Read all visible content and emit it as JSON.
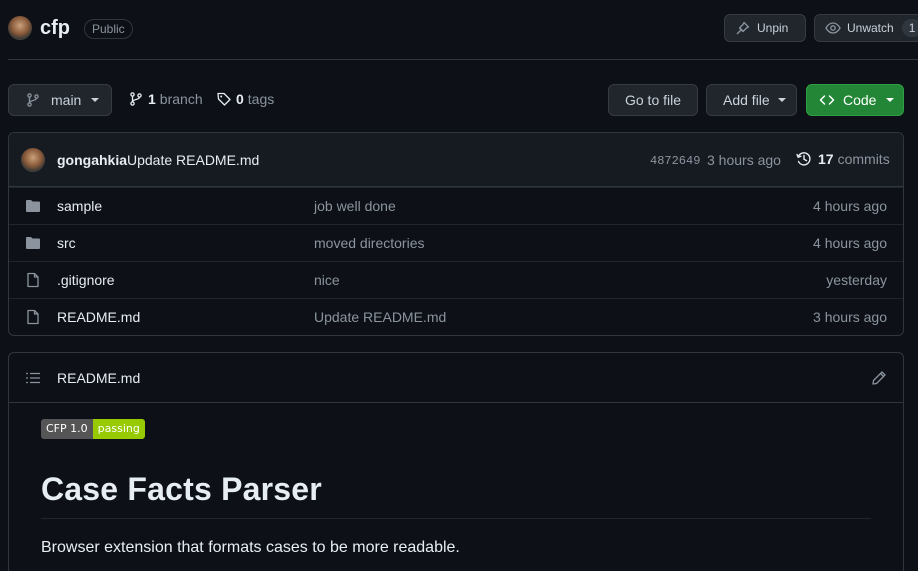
{
  "repo": {
    "name": "cfp",
    "visibility": "Public",
    "unpin_label": "Unpin",
    "unwatch_label": "Unwatch",
    "watch_count": "1"
  },
  "toolbar": {
    "branch": "main",
    "branch_count": "1",
    "branch_word": "branch",
    "tag_count": "0",
    "tag_word": "tags",
    "goto_label": "Go to file",
    "addfile_label": "Add file",
    "code_label": "Code"
  },
  "commit": {
    "author": "gongahkia",
    "message": "Update README.md",
    "sha": "4872649",
    "time": "3 hours ago",
    "count": "17",
    "count_word": "commits"
  },
  "files": [
    {
      "name": "sample",
      "type": "folder",
      "message": "job well done",
      "age": "4 hours ago"
    },
    {
      "name": "src",
      "type": "folder",
      "message": "moved directories",
      "age": "4 hours ago"
    },
    {
      "name": ".gitignore",
      "type": "file",
      "message": "nice",
      "age": "yesterday"
    },
    {
      "name": "README.md",
      "type": "file",
      "message": "Update README.md",
      "age": "3 hours ago"
    }
  ],
  "readme": {
    "filename": "README.md",
    "badge_left": "CFP 1.0",
    "badge_right": "passing",
    "heading": "Case Facts Parser",
    "description": "Browser extension that formats cases to be more readable."
  },
  "colors": {
    "background": "#0d1117",
    "code_button": "#238636",
    "badge_pass": "#97ca00",
    "muted_text": "#8b949e"
  },
  "icons": [
    "pin-icon",
    "eye-icon",
    "git-branch-icon",
    "tag-icon",
    "clock-history-icon",
    "folder-icon",
    "file-icon",
    "list-icon",
    "pencil-icon",
    "code-icon"
  ]
}
